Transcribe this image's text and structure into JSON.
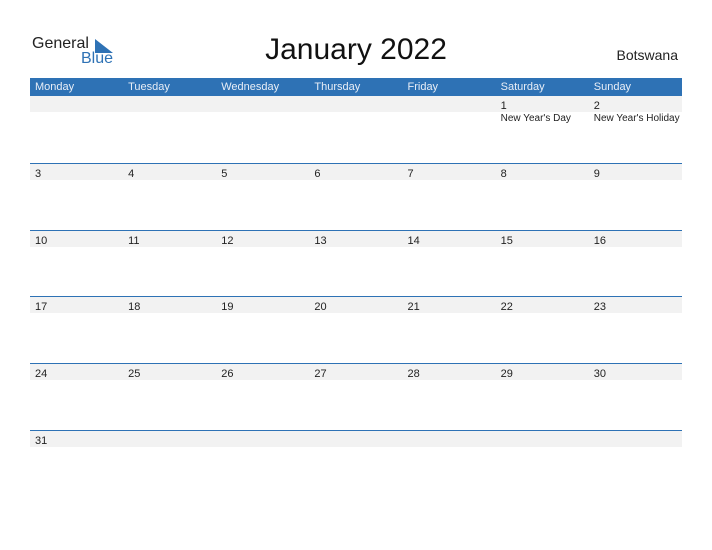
{
  "logo": {
    "word1": "General",
    "word2": "Blue"
  },
  "title": "January 2022",
  "country": "Botswana",
  "weekdays": [
    "Monday",
    "Tuesday",
    "Wednesday",
    "Thursday",
    "Friday",
    "Saturday",
    "Sunday"
  ],
  "weeks": [
    [
      {
        "d": ""
      },
      {
        "d": ""
      },
      {
        "d": ""
      },
      {
        "d": ""
      },
      {
        "d": ""
      },
      {
        "d": "1",
        "event": "New Year's Day"
      },
      {
        "d": "2",
        "event": "New Year's Holiday"
      }
    ],
    [
      {
        "d": "3"
      },
      {
        "d": "4"
      },
      {
        "d": "5"
      },
      {
        "d": "6"
      },
      {
        "d": "7"
      },
      {
        "d": "8"
      },
      {
        "d": "9"
      }
    ],
    [
      {
        "d": "10"
      },
      {
        "d": "11"
      },
      {
        "d": "12"
      },
      {
        "d": "13"
      },
      {
        "d": "14"
      },
      {
        "d": "15"
      },
      {
        "d": "16"
      }
    ],
    [
      {
        "d": "17"
      },
      {
        "d": "18"
      },
      {
        "d": "19"
      },
      {
        "d": "20"
      },
      {
        "d": "21"
      },
      {
        "d": "22"
      },
      {
        "d": "23"
      }
    ],
    [
      {
        "d": "24"
      },
      {
        "d": "25"
      },
      {
        "d": "26"
      },
      {
        "d": "27"
      },
      {
        "d": "28"
      },
      {
        "d": "29"
      },
      {
        "d": "30"
      }
    ],
    [
      {
        "d": "31"
      },
      {
        "d": ""
      },
      {
        "d": ""
      },
      {
        "d": ""
      },
      {
        "d": ""
      },
      {
        "d": ""
      },
      {
        "d": ""
      }
    ]
  ],
  "colors": {
    "accent": "#2e72b5",
    "band": "#f2f2f2"
  }
}
